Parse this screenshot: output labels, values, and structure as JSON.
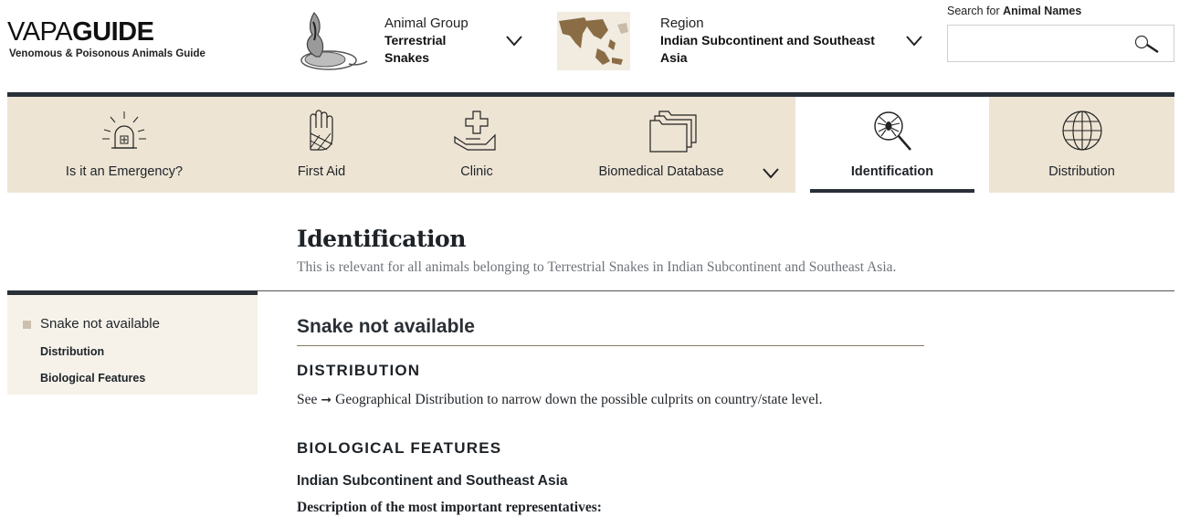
{
  "header": {
    "logo_light": "VAPA",
    "logo_bold": "GUIDE",
    "logo_subtitle": "Venomous & Poisonous Animals Guide",
    "animal_group": {
      "label": "Animal Group",
      "value_line1": "Terrestrial",
      "value_line2": "Snakes"
    },
    "region": {
      "label": "Region",
      "value_line1": "Indian Subcontinent and Southeast",
      "value_line2": "Asia"
    },
    "search": {
      "label_prefix": "Search for ",
      "label_bold": "Animal Names",
      "value": "",
      "placeholder": ""
    }
  },
  "nav": {
    "tabs": [
      {
        "label": "Is it an Emergency?",
        "icon": "emergency-light-icon"
      },
      {
        "label": "First Aid",
        "icon": "bandaged-hand-icon"
      },
      {
        "label": "Clinic",
        "icon": "hand-with-cross-icon"
      },
      {
        "label": "Biomedical Database",
        "icon": "folders-icon"
      },
      {
        "label": "Identification",
        "icon": "spider-magnifier-icon",
        "active": true
      },
      {
        "label": "Distribution",
        "icon": "globe-icon"
      }
    ]
  },
  "page": {
    "title": "Identification",
    "subtitle": "This is relevant for all animals belonging to Terrestrial Snakes in Indian Subcontinent and Southeast Asia."
  },
  "sidebar": {
    "items": [
      {
        "label": "Snake not available"
      },
      {
        "label": "Distribution"
      },
      {
        "label": "Biological Features"
      }
    ]
  },
  "content": {
    "heading": "Snake not available",
    "distribution_heading": "DISTRIBUTION",
    "distribution_see": "See",
    "distribution_link": "Geographical Distribution",
    "distribution_rest": " to narrow down the possible culprits on country/state level.",
    "bio_heading": "BIOLOGICAL FEATURES",
    "region_heading": "Indian Subcontinent and Southeast Asia",
    "representatives": "Description of the most important representatives:"
  },
  "colors": {
    "accent_dark": "#2a3038",
    "nav_bg": "#ede4d4",
    "sidebar_bg": "#f6f2ea"
  }
}
